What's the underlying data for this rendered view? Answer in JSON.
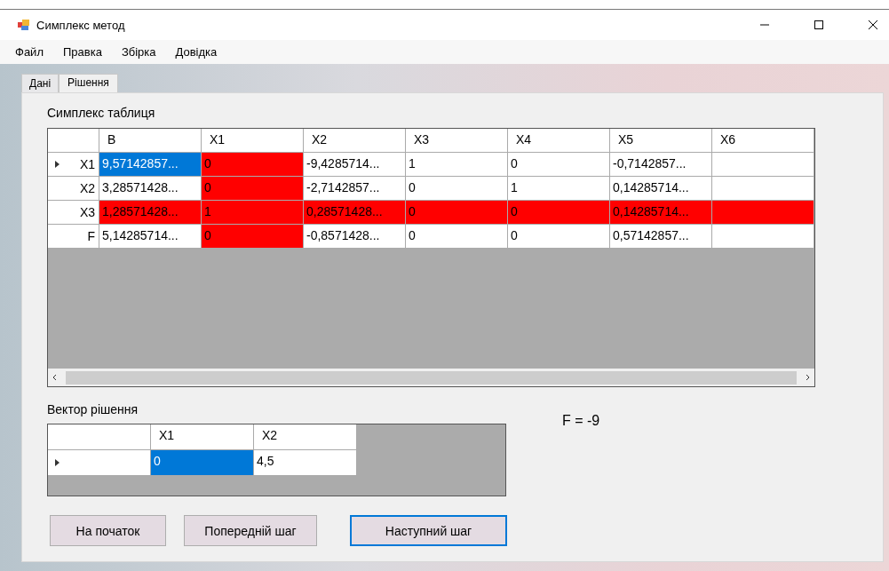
{
  "window": {
    "title": "Симплекс метод"
  },
  "menu": [
    {
      "label": "Файл"
    },
    {
      "label": "Правка"
    },
    {
      "label": "Збірка"
    },
    {
      "label": "Довідка"
    }
  ],
  "tabs": [
    {
      "label": "Дані",
      "selected": false
    },
    {
      "label": "Рішення",
      "selected": true
    }
  ],
  "simplex_table": {
    "title": "Симплекс таблиця",
    "columns": [
      "B",
      "X1",
      "X2",
      "X3",
      "X4",
      "X5",
      "X6"
    ],
    "rows": [
      {
        "header": "X1",
        "current": true,
        "cells": [
          {
            "text": "9,57142857...",
            "selected": true,
            "highlighted": false
          },
          {
            "text": "0",
            "selected": false,
            "highlighted": true
          },
          {
            "text": "-9,4285714...",
            "selected": false,
            "highlighted": false
          },
          {
            "text": "1",
            "selected": false,
            "highlighted": false
          },
          {
            "text": "0",
            "selected": false,
            "highlighted": false
          },
          {
            "text": "-0,7142857...",
            "selected": false,
            "highlighted": false
          },
          {
            "selected": false,
            "highlighted": false
          }
        ]
      },
      {
        "header": "X2",
        "current": false,
        "cells": [
          {
            "text": "3,28571428...",
            "selected": false,
            "highlighted": false
          },
          {
            "text": "0",
            "selected": false,
            "highlighted": true
          },
          {
            "text": "-2,7142857...",
            "selected": false,
            "highlighted": false
          },
          {
            "text": "0",
            "selected": false,
            "highlighted": false
          },
          {
            "text": "1",
            "selected": false,
            "highlighted": false
          },
          {
            "text": "0,14285714...",
            "selected": false,
            "highlighted": false
          },
          {
            "selected": false,
            "highlighted": false
          }
        ]
      },
      {
        "header": "X3",
        "current": false,
        "cells": [
          {
            "text": "1,28571428...",
            "selected": false,
            "highlighted": true
          },
          {
            "text": "1",
            "selected": false,
            "highlighted": true
          },
          {
            "text": "0,28571428...",
            "selected": false,
            "highlighted": true
          },
          {
            "text": "0",
            "selected": false,
            "highlighted": true
          },
          {
            "text": "0",
            "selected": false,
            "highlighted": true
          },
          {
            "text": "0,14285714...",
            "selected": false,
            "highlighted": true
          },
          {
            "selected": false,
            "highlighted": true
          }
        ]
      },
      {
        "header": "F",
        "current": false,
        "cells": [
          {
            "text": "5,14285714...",
            "selected": false,
            "highlighted": false
          },
          {
            "text": "0",
            "selected": false,
            "highlighted": true
          },
          {
            "text": "-0,8571428...",
            "selected": false,
            "highlighted": false
          },
          {
            "text": "0",
            "selected": false,
            "highlighted": false
          },
          {
            "text": "0",
            "selected": false,
            "highlighted": false
          },
          {
            "text": "0,57142857...",
            "selected": false,
            "highlighted": false
          },
          {
            "selected": false,
            "highlighted": false
          }
        ]
      }
    ]
  },
  "solution_vector": {
    "title": "Вектор рішення",
    "columns": [
      "X1",
      "X2"
    ],
    "rows": [
      {
        "current": true,
        "cells": [
          {
            "text": "0",
            "selected": true,
            "highlighted": false
          },
          {
            "text": "4,5",
            "selected": false,
            "highlighted": false
          }
        ]
      }
    ]
  },
  "objective": "F = -9",
  "buttons": [
    {
      "label": "На початок",
      "focused": false
    },
    {
      "label": "Попередній шаг",
      "focused": false
    },
    {
      "label": "Наступний шаг",
      "focused": true
    }
  ]
}
